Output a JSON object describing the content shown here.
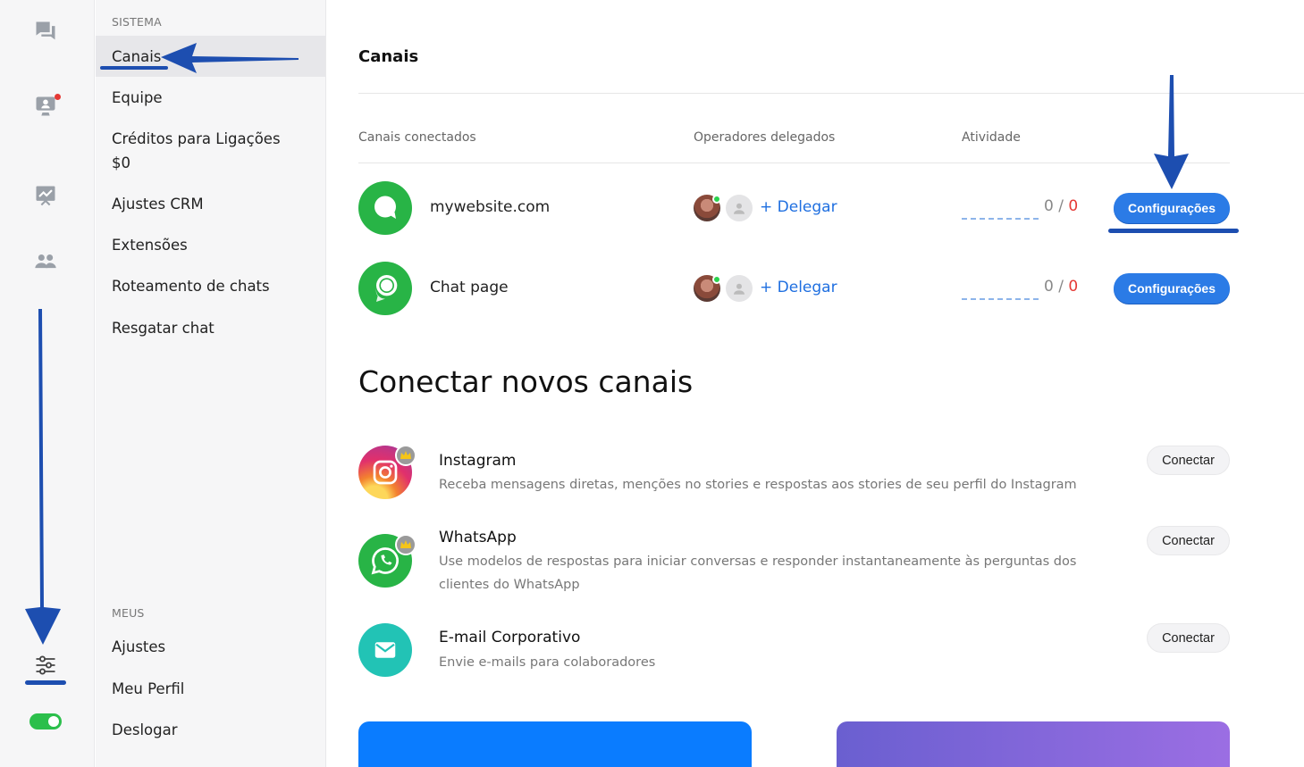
{
  "sidebar": {
    "section_system": "SISTEMA",
    "items": [
      {
        "label": "Canais"
      },
      {
        "label": "Equipe"
      },
      {
        "label": "Créditos para Ligações",
        "sub": "$0"
      },
      {
        "label": "Ajustes CRM"
      },
      {
        "label": "Extensões"
      },
      {
        "label": "Roteamento de chats"
      },
      {
        "label": "Resgatar chat"
      }
    ],
    "section_mine": "MEUS",
    "mine_items": [
      {
        "label": "Ajustes"
      },
      {
        "label": "Meu Perfil"
      },
      {
        "label": "Deslogar"
      }
    ]
  },
  "rail": {
    "icons": [
      "chat-bubbles-icon",
      "operator-board-icon",
      "analytics-board-icon",
      "team-icon",
      "settings-sliders-icon"
    ],
    "status_toggle": "on"
  },
  "main": {
    "title": "Canais",
    "columns": {
      "channels": "Canais conectados",
      "operators": "Operadores delegados",
      "activity": "Atividade"
    },
    "channels": [
      {
        "name": "mywebsite.com",
        "delegate": "+ Delegar",
        "count_a": "0",
        "sep": " / ",
        "count_b": "0",
        "button": "Configurações"
      },
      {
        "name": "Chat page",
        "delegate": "+ Delegar",
        "count_a": "0",
        "sep": " / ",
        "count_b": "0",
        "button": "Configurações"
      }
    ],
    "connect_title": "Conectar novos canais",
    "new_channels": [
      {
        "name": "Instagram",
        "desc": "Receba mensagens diretas, menções no stories e respostas aos stories de seu perfil do Instagram",
        "button": "Conectar"
      },
      {
        "name": "WhatsApp",
        "desc": "Use modelos de respostas para iniciar conversas e responder instantaneamente às perguntas dos clientes do WhatsApp",
        "button": "Conectar"
      },
      {
        "name": "E-mail Corporativo",
        "desc": "Envie e-mails para colaboradores",
        "button": "Conectar"
      }
    ]
  },
  "colors": {
    "accent": "#2b7be6",
    "green": "#28b446",
    "annotation": "#1d4eb0"
  }
}
